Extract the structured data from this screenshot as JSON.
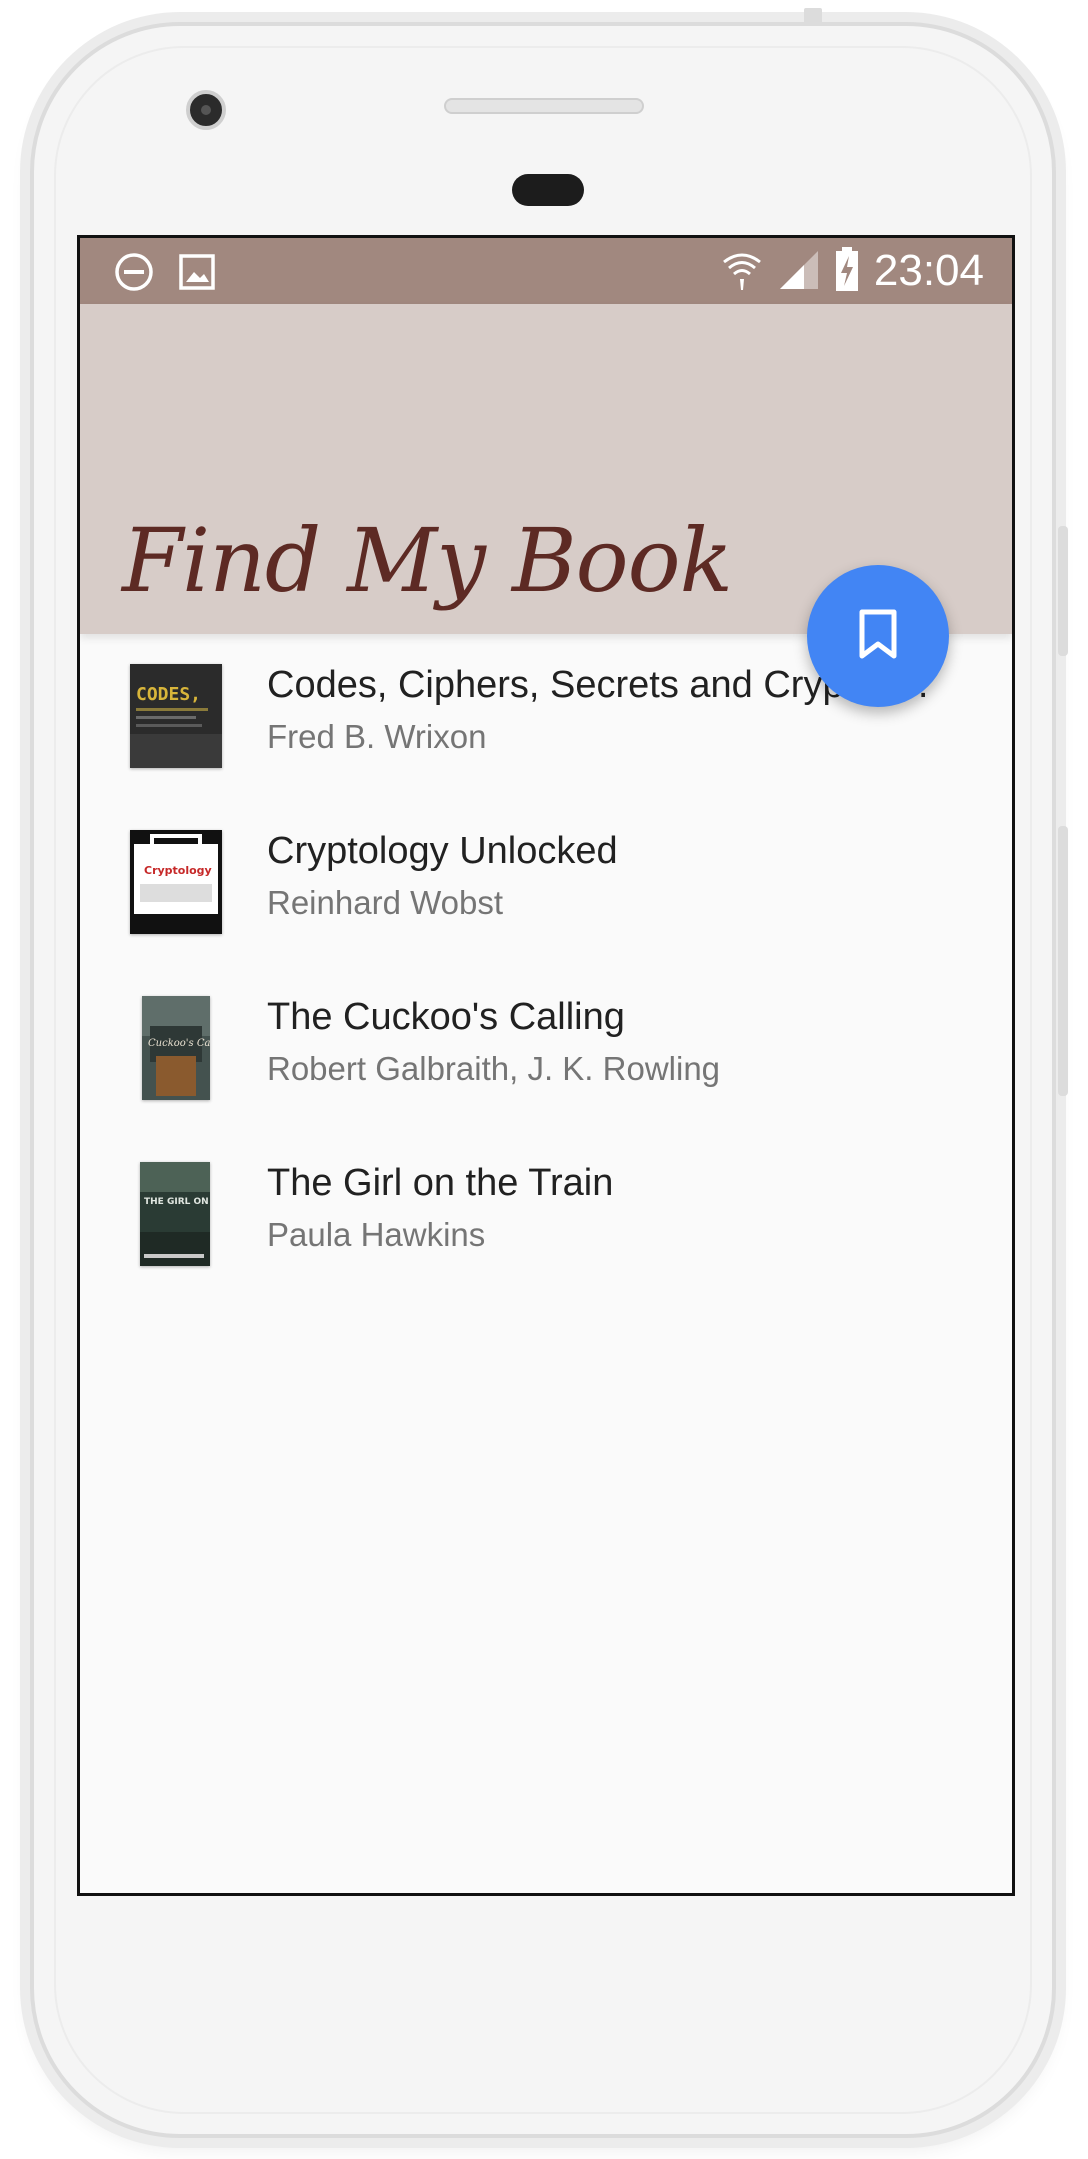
{
  "status_bar": {
    "time": "23:04",
    "left_icons": [
      "do-not-disturb-icon",
      "image-icon"
    ],
    "right_icons": [
      "wifi-icon",
      "cell-signal-icon",
      "battery-charging-icon"
    ]
  },
  "app_bar": {
    "title": "Find My Book",
    "background_color": "#d7ccc8",
    "title_color": "#5d2a24"
  },
  "fab": {
    "icon": "bookmark-icon",
    "color": "#4285f4"
  },
  "books": [
    {
      "title": "Codes, Ciphers, Secrets and Cryptic Communication",
      "author": "Fred B. Wrixon",
      "cover_text": "CODES,"
    },
    {
      "title": "Cryptology Unlocked",
      "author": "Reinhard Wobst",
      "cover_text": "Cryptology"
    },
    {
      "title": "The Cuckoo's Calling",
      "author": "Robert Galbraith, J. K. Rowling",
      "cover_text": "Cuckoo's Calling"
    },
    {
      "title": "The Girl on the Train",
      "author": "Paula Hawkins",
      "cover_text": "THE GIRL ON THE TRAIN"
    }
  ],
  "colors": {
    "status_bar": "#a1887f",
    "list_background": "#fafafa"
  }
}
